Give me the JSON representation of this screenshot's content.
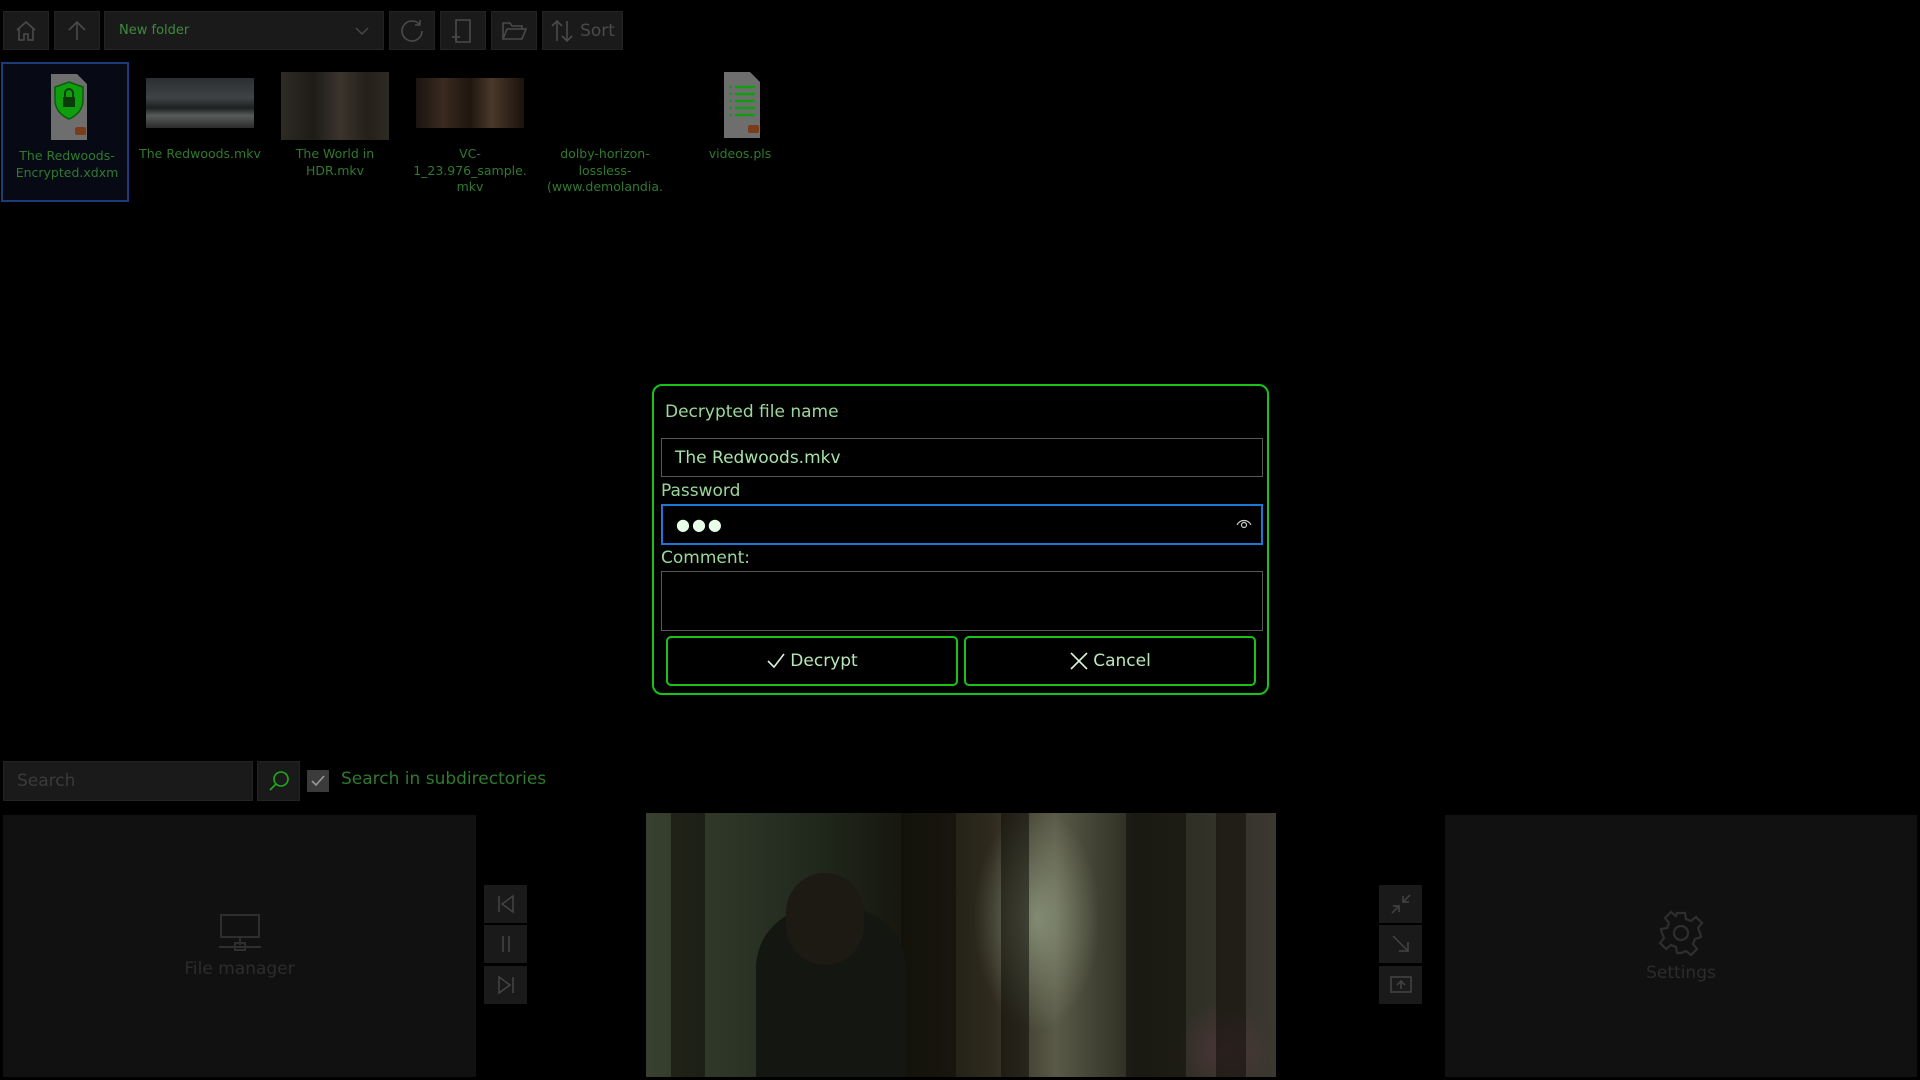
{
  "toolbar": {
    "folder_select_value": "New folder",
    "sort_label": "Sort"
  },
  "files": [
    {
      "name": "The Redwoods-Encrypted.xdxm",
      "selected": true,
      "icon": "encrypted-file-icon"
    },
    {
      "name": "The Redwoods.mkv",
      "icon": "video-thumbnail"
    },
    {
      "name": "The World in HDR.mkv",
      "icon": "video-thumbnail"
    },
    {
      "name": "VC-1_23.976_sample.mkv",
      "icon": "video-thumbnail"
    },
    {
      "name": "dolby-horizon-lossless-(www.demolandia.",
      "icon": "none"
    },
    {
      "name": "videos.pls",
      "icon": "playlist-file-icon"
    }
  ],
  "dialog": {
    "title": "Decrypted file name",
    "filename_value": "The Redwoods.mkv",
    "password_label": "Password",
    "password_value": "●●●",
    "comment_label": "Comment:",
    "comment_value": "",
    "decrypt_label": "Decrypt",
    "cancel_label": "Cancel"
  },
  "search": {
    "placeholder": "Search",
    "subdirectories_label": "Search in subdirectories",
    "subdirectories_checked": true
  },
  "panels": {
    "file_manager_label": "File manager",
    "settings_label": "Settings"
  },
  "colors": {
    "accent_green": "#16c316",
    "focus_blue": "#1c78d4",
    "text_green": "#3d8a3d",
    "background": "#000000"
  }
}
